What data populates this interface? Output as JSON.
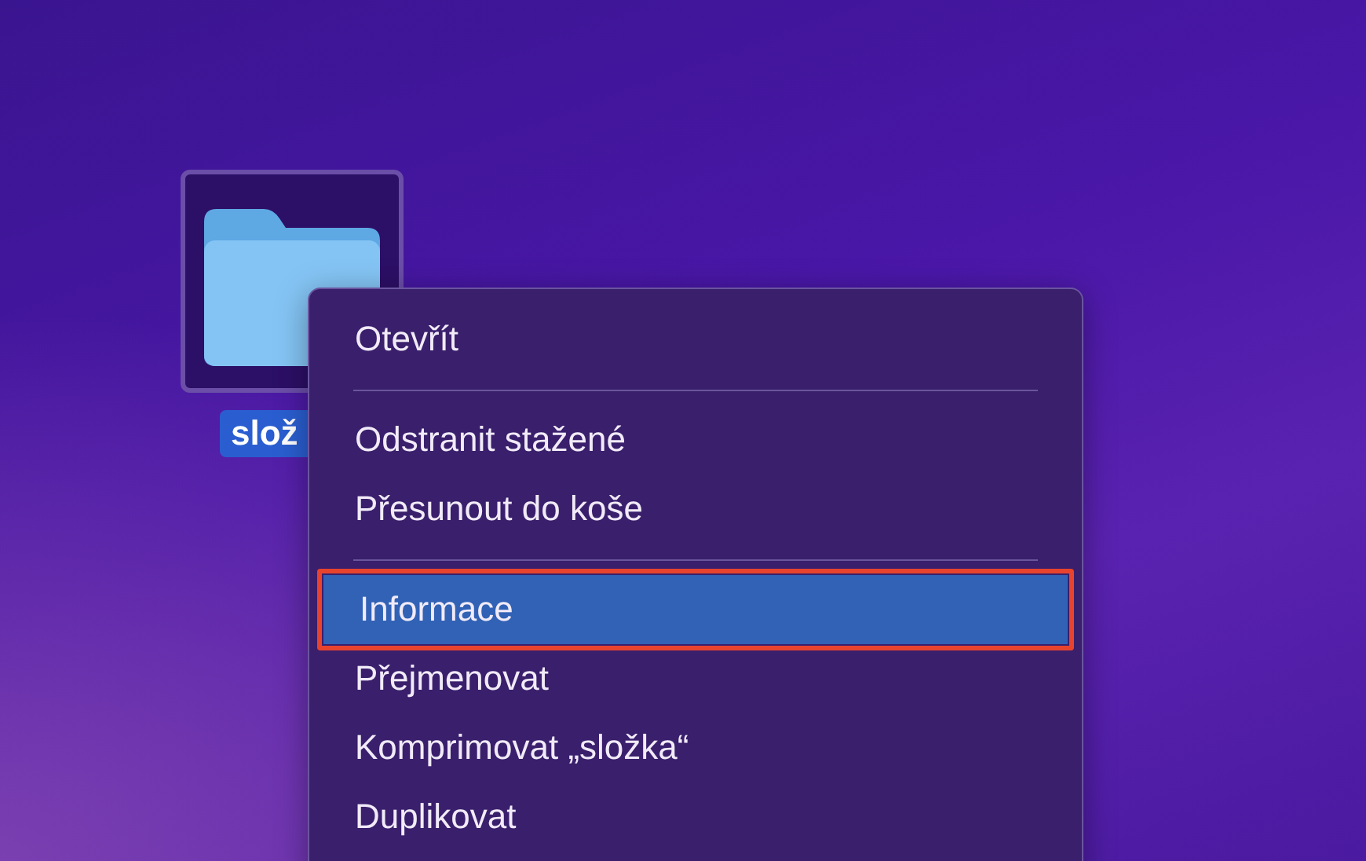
{
  "desktop": {
    "icon": {
      "label": "slož",
      "selected": true
    }
  },
  "context_menu": {
    "items": [
      {
        "kind": "item",
        "label": "Otevřít",
        "selected": false,
        "outlined": false
      },
      {
        "kind": "separator"
      },
      {
        "kind": "item",
        "label": "Odstranit stažené",
        "selected": false,
        "outlined": false
      },
      {
        "kind": "item",
        "label": "Přesunout do koše",
        "selected": false,
        "outlined": false
      },
      {
        "kind": "separator"
      },
      {
        "kind": "item",
        "label": "Informace",
        "selected": true,
        "outlined": true
      },
      {
        "kind": "item",
        "label": "Přejmenovat",
        "selected": false,
        "outlined": false
      },
      {
        "kind": "item",
        "label": "Komprimovat „složka“",
        "selected": false,
        "outlined": false
      },
      {
        "kind": "item",
        "label": "Duplikovat",
        "selected": false,
        "outlined": false
      }
    ]
  }
}
